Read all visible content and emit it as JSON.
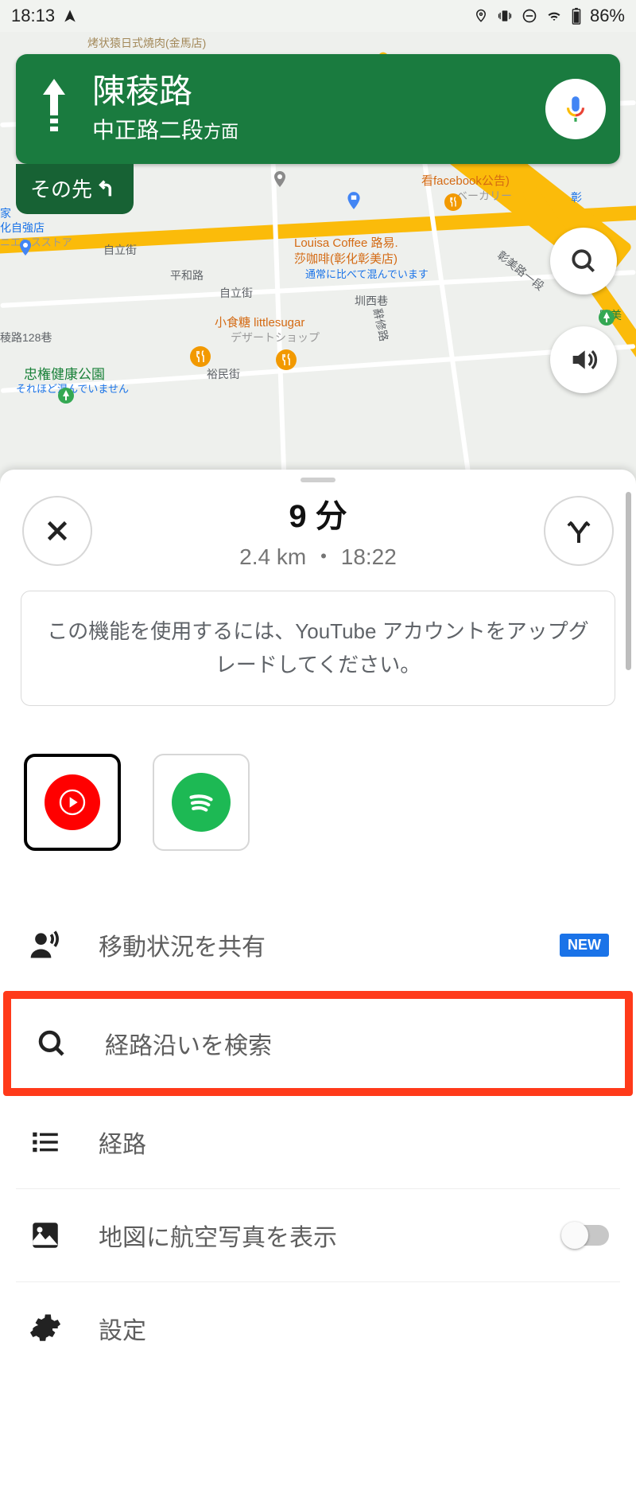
{
  "status": {
    "time": "18:13",
    "battery": "86%"
  },
  "nav": {
    "street": "陳稜路",
    "toward_main": "中正路二段",
    "toward_suffix": "方面",
    "next_label": "その先"
  },
  "map": {
    "poi1": "烤状猿日式燒肉(金馬店)",
    "poi2": "看facebook公告)",
    "poi2b": "ベーカリー",
    "poi3a": "Louisa Coffee 路易.",
    "poi3b": "莎咖啡(彰化彰美店)",
    "poi3c": "通常に比べて混んでいます",
    "poi4a": "小食糖 littlesugar",
    "poi4b": "デザートショップ",
    "poi5": "忠権健康公園",
    "poi5b": "それほど混んでいません",
    "poi6a": "家",
    "poi6b": "化自強店",
    "poi6c": "ニエンスストア",
    "poi7": "彰",
    "poi8": "園美",
    "st1": "自立街",
    "st2": "平和路",
    "st3": "自立街",
    "st4": "彰美路一段",
    "st5": "辭修路",
    "st6": "裕民街",
    "st7": "稜路128巷",
    "st8": "圳西巷"
  },
  "sheet": {
    "eta_time": "9 分",
    "eta_detail": "2.4 km  ・  18:22",
    "info": "この機能を使用するには、YouTube アカウントをアップグレードしてください。",
    "share_label": "移動状況を共有",
    "new_badge": "NEW",
    "search_label": "経路沿いを検索",
    "route_label": "経路",
    "satellite_label": "地図に航空写真を表示",
    "settings_label": "設定"
  }
}
